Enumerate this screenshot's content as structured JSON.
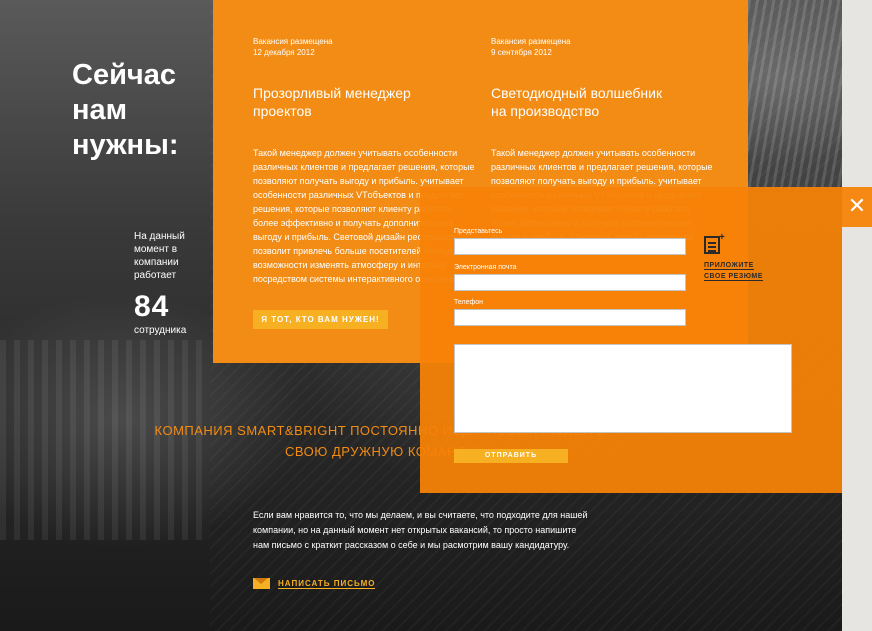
{
  "hero": {
    "headline": "Сейчас нам нужны:",
    "stats_prefix": "На данный момент в компании работает",
    "employee_count": "84",
    "stats_suffix": "сотрудника"
  },
  "jobs": [
    {
      "posted_label": "Вакансия размещена",
      "posted_date": "12 декабря 2012",
      "title": "Прозорливый менеджер проектов",
      "description": "Такой менеджер должен учитывать особенности различных клиентов и предлагает решения, которые позволяют получать выгоду и прибыль. учитывает особенности различных VTобъектов и предлагает решения, которые позволяют клиенту работать более эффективно и получать дополнительные выгоду и прибыль. Световой дизайн ресторанов позволит привлечь больше посетителей благодаря возможности изменять атмосферу и интерьер посредством системы интерактивного освещения."
    },
    {
      "posted_label": "Вакансия размещена",
      "posted_date": "9 сентября 2012",
      "title": "Светодиодный волшебник на производство",
      "description": "Такой менеджер должен учитывать особенности различных клиентов и предлагает решения, которые позволяют получать выгоду и прибыль. учитывает особенности различных VTобъектов и предлагает решения, которые позволяют клиенту работать более эффективно и получать дополнительные выгоду и прибыль. Световой дизайн ресторанов позволит привлечь больше посетителей."
    }
  ],
  "cta_button": "Я ТОТ, КТО ВАМ НУЖЕН!",
  "tagline": "КОМПАНИЯ SMART&BRIGHT ПОСТОЯННО ИЩЕТ НОВЫХ ЛЮДЕЙ В СВОЮ ДРУЖНУЮ КОМАНДУ",
  "intro": "Если вам нравится то, что мы делаем, и вы считаете, что подходите для нашей компании, но на данный момент нет открытых вакансий, то просто напишите нам письмо с краткит рассказом о себе и мы расмотрим вашу кандидатуру.",
  "write_link": "НАПИСАТЬ ПИСЬМО",
  "form": {
    "close": "✕",
    "name_label": "Представьтесь",
    "email_label": "Электронная почта",
    "phone_label": "Телефон",
    "name_value": "",
    "email_value": "",
    "phone_value": "",
    "message_value": "",
    "attach_line1": "ПРИЛОЖИТЕ",
    "attach_line2": "СВОЕ РЕЗЮМЕ",
    "submit": "ОТПРАВИТЬ"
  },
  "colors": {
    "accent": "#f28c14",
    "button": "#f7b021"
  }
}
